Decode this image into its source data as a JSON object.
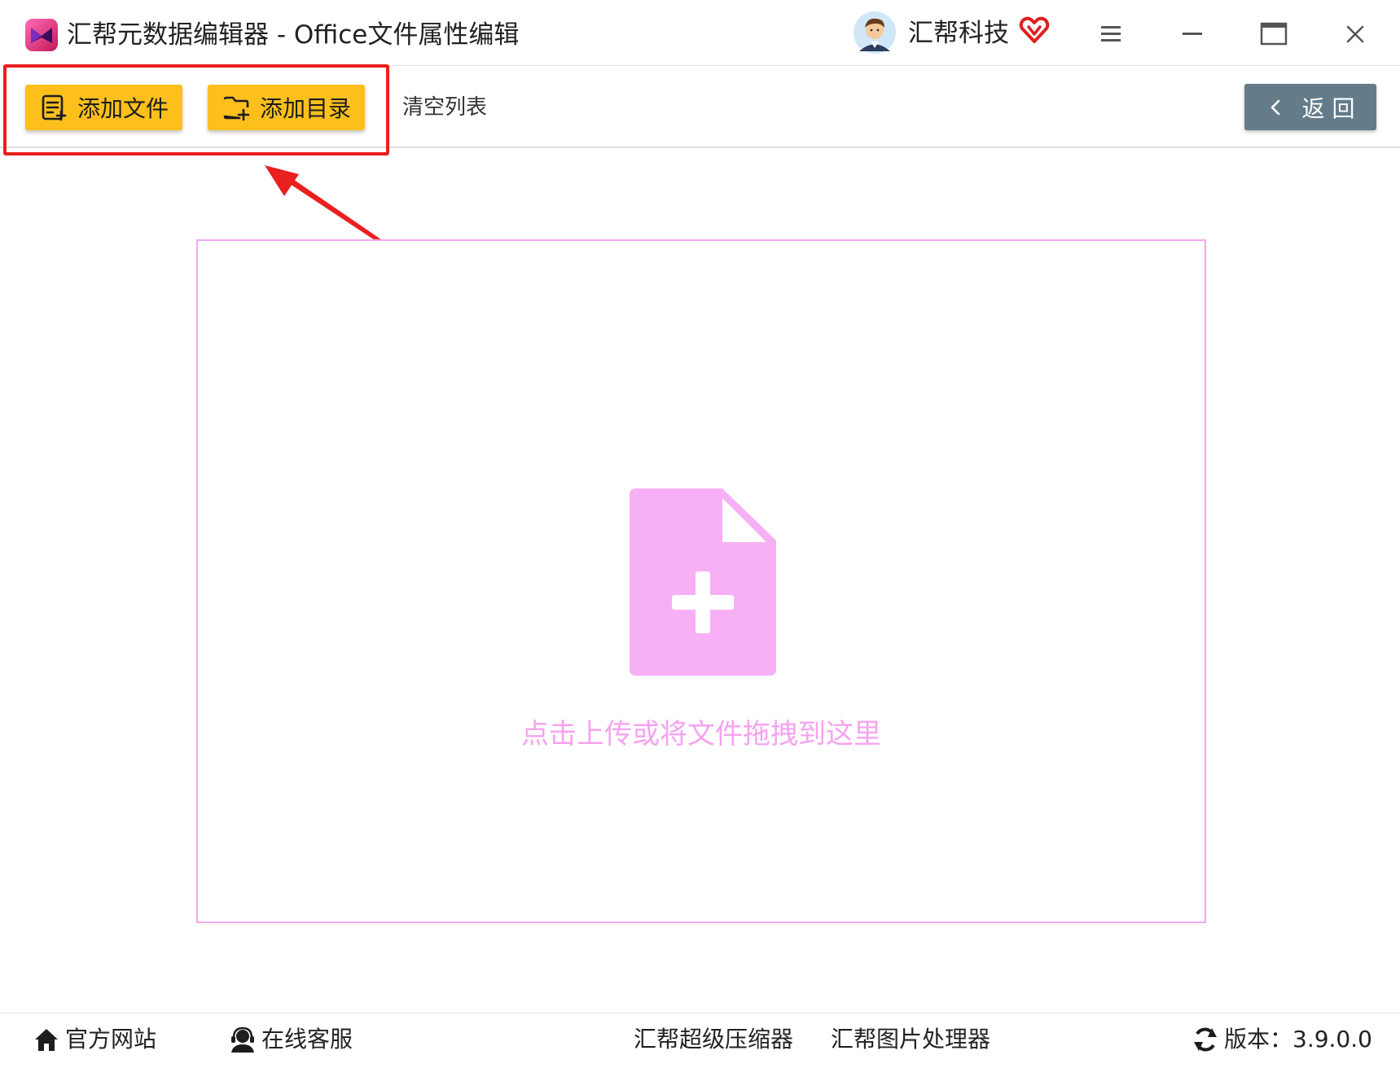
{
  "titlebar": {
    "title": "汇帮元数据编辑器 - Office文件属性编辑",
    "user_name": "汇帮科技",
    "icons": [
      "app-logo-icon",
      "avatar-icon",
      "vip-heart-icon",
      "menu-icon",
      "minimize-icon",
      "maximize-icon",
      "close-icon"
    ]
  },
  "toolbar": {
    "add_file_label": "添加文件",
    "add_folder_label": "添加目录",
    "clear_list_label": "清空列表",
    "back_label": "返 回"
  },
  "drop_zone": {
    "hint": "点击上传或将文件拖拽到这里"
  },
  "statusbar": {
    "website_label": "官方网站",
    "support_label": "在线客服",
    "compressor_label": "汇帮超级压缩器",
    "image_tool_label": "汇帮图片处理器",
    "version_label": "版本：3.9.0.0"
  },
  "colors": {
    "accent_yellow": "#fcbf1c",
    "back_button": "#647c8a",
    "annotation_red": "#ea1f1f",
    "drop_pink": "#f6a3f0"
  }
}
